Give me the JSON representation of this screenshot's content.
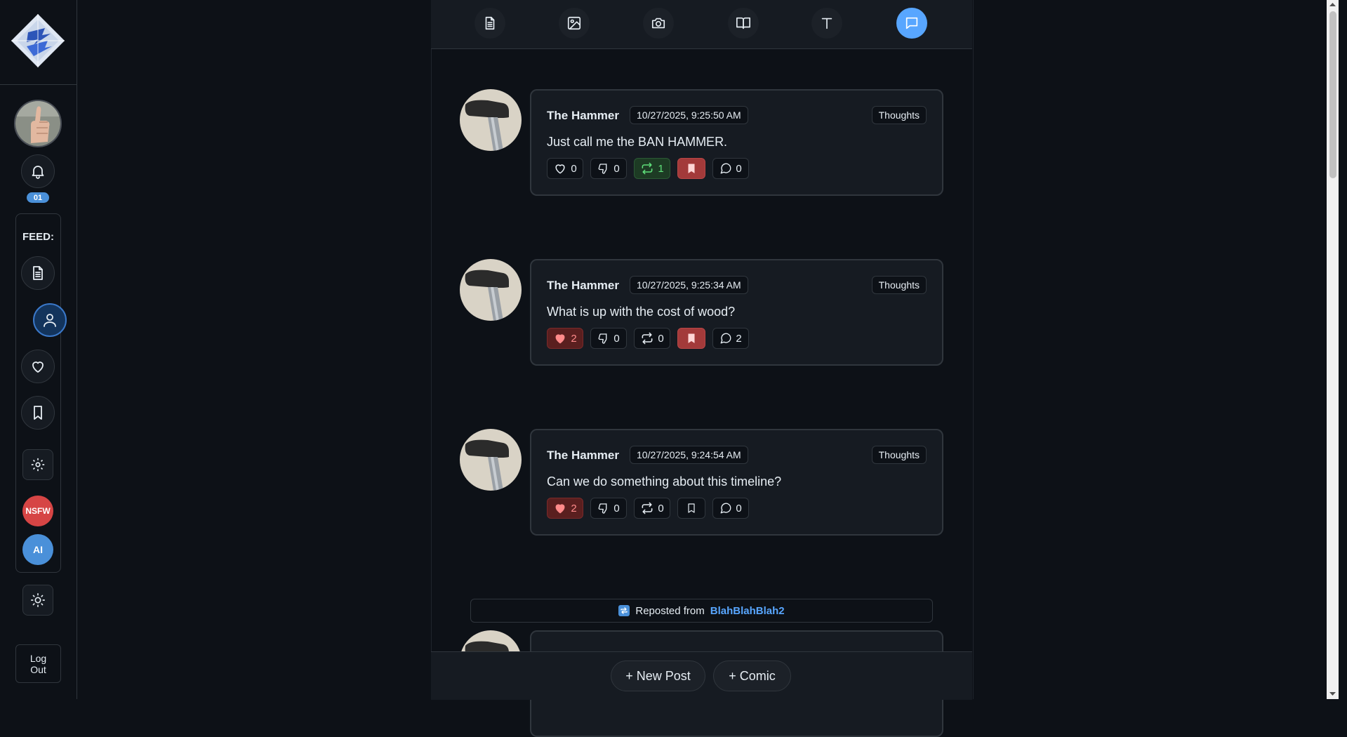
{
  "sidebar": {
    "notif_count": "01",
    "feed_label": "FEED:",
    "nsfw_label": "NSFW",
    "ai_label": "AI",
    "logout_line1": "Log",
    "logout_line2": "Out"
  },
  "topbar": {
    "tabs": [
      {
        "icon": "document-icon"
      },
      {
        "icon": "image-icon"
      },
      {
        "icon": "camera-icon"
      },
      {
        "icon": "book-icon"
      },
      {
        "icon": "text-icon"
      },
      {
        "icon": "chat-icon",
        "active": true
      }
    ]
  },
  "posts": [
    {
      "author": "The Hammer",
      "date": "10/27/2025, 9:25:50 AM",
      "tag": "Thoughts",
      "content": "Just call me the BAN HAMMER.",
      "likes": "0",
      "dislikes": "0",
      "reposts": "1",
      "comments": "0",
      "liked": false,
      "reposted": true,
      "saved": true
    },
    {
      "author": "The Hammer",
      "date": "10/27/2025, 9:25:34 AM",
      "tag": "Thoughts",
      "content": "What is up with the cost of wood?",
      "likes": "2",
      "dislikes": "0",
      "reposts": "0",
      "comments": "2",
      "liked": true,
      "reposted": false,
      "saved": true
    },
    {
      "author": "The Hammer",
      "date": "10/27/2025, 9:24:54 AM",
      "tag": "Thoughts",
      "content": "Can we do something about this timeline?",
      "likes": "2",
      "dislikes": "0",
      "reposts": "0",
      "comments": "0",
      "liked": true,
      "reposted": false,
      "saved": false
    }
  ],
  "repost_notice": {
    "prefix": "Reposted from",
    "user": "BlahBlahBlah2"
  },
  "bottombar": {
    "new_post_label": "+ New Post",
    "comic_label": "+ Comic"
  },
  "colors": {
    "background": "#0d1117",
    "card": "#161b22",
    "accent": "#58a6ff",
    "like": "#ff8b8b",
    "repost": "#5fe07a",
    "bookmark": "#a33a3a",
    "nsfw": "#d64545",
    "ai": "#4a90d9"
  }
}
